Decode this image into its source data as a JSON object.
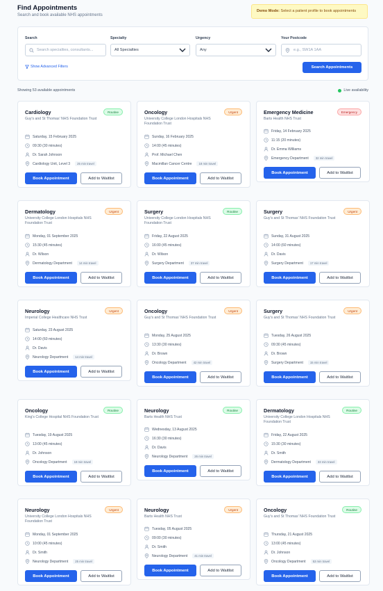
{
  "header": {
    "title": "Find Appointments",
    "subtitle": "Search and book available NHS appointments"
  },
  "demo": {
    "label": "Demo Mode:",
    "text": "Select a patient profile to book appointments"
  },
  "filters": {
    "search_label": "Search",
    "search_placeholder": "Search specialties, consultants...",
    "specialty_label": "Specialty",
    "specialty_value": "All Specialties",
    "urgency_label": "Urgency",
    "urgency_value": "Any",
    "postcode_label": "Your Postcode",
    "postcode_placeholder": "e.g., SW1A 1AA",
    "advanced_label": "Show Advanced Filters",
    "search_button": "Search Appointments"
  },
  "results": {
    "showing": "Showing 53 available appointments",
    "live": "Live availability"
  },
  "buttons": {
    "book": "Book Appointment",
    "waitlist": "Add to Waitlist"
  },
  "cards": [
    {
      "specialty": "Cardiology",
      "trust": "Guy's and St Thomas' NHS Foundation Trust",
      "urgency": "Routine",
      "date": "Saturday, 15 February 2025",
      "time": "09:30 (30 minutes)",
      "doctor": "Dr. Sarah Johnson",
      "location": "Cardiology Unit, Level 3",
      "travel": "25 min travel"
    },
    {
      "specialty": "Oncology",
      "trust": "University College London Hospitals NHS Foundation Trust",
      "urgency": "Urgent",
      "date": "Sunday, 16 February 2025",
      "time": "14:00 (45 minutes)",
      "doctor": "Prof. Michael Chen",
      "location": "Macmillan Cancer Centre",
      "travel": "18 min travel"
    },
    {
      "specialty": "Emergency Medicine",
      "trust": "Barts Health NHS Trust",
      "urgency": "Emergency",
      "date": "Friday, 14 February 2025",
      "time": "11:15 (20 minutes)",
      "doctor": "Dr. Emma Williams",
      "location": "Emergency Department",
      "travel": "32 min travel"
    },
    {
      "specialty": "Dermatology",
      "trust": "University College London Hospitals NHS Foundation Trust",
      "urgency": "Urgent",
      "date": "Monday, 01 September 2025",
      "time": "15:30 (45 minutes)",
      "doctor": "Dr. Wilson",
      "location": "Dermatology Department",
      "travel": "14 min travel"
    },
    {
      "specialty": "Surgery",
      "trust": "University College London Hospitals NHS Foundation Trust",
      "urgency": "Routine",
      "date": "Friday, 22 August 2025",
      "time": "16:00 (45 minutes)",
      "doctor": "Dr. Wilson",
      "location": "Surgery Department",
      "travel": "37 min travel"
    },
    {
      "specialty": "Surgery",
      "trust": "Guy's and St Thomas' NHS Foundation Trust",
      "urgency": "Urgent",
      "date": "Sunday, 31 August 2025",
      "time": "14:00 (60 minutes)",
      "doctor": "Dr. Davis",
      "location": "Surgery Department",
      "travel": "17 min travel"
    },
    {
      "specialty": "Neurology",
      "trust": "Imperial College Healthcare NHS Trust",
      "urgency": "Urgent",
      "date": "Saturday, 23 August 2025",
      "time": "14:00 (60 minutes)",
      "doctor": "Dr. Davis",
      "location": "Neurology Department",
      "travel": "14 min travel"
    },
    {
      "specialty": "Oncology",
      "trust": "Guy's and St Thomas' NHS Foundation Trust",
      "urgency": "Urgent",
      "date": "Monday, 25 August 2025",
      "time": "13:30 (30 minutes)",
      "doctor": "Dr. Brown",
      "location": "Oncology Department",
      "travel": "42 min travel"
    },
    {
      "specialty": "Surgery",
      "trust": "Guy's and St Thomas' NHS Foundation Trust",
      "urgency": "Urgent",
      "date": "Tuesday, 26 August 2025",
      "time": "09:30 (45 minutes)",
      "doctor": "Dr. Brown",
      "location": "Surgery Department",
      "travel": "15 min travel"
    },
    {
      "specialty": "Oncology",
      "trust": "King's College Hospital NHS Foundation Trust",
      "urgency": "Routine",
      "date": "Tuesday, 19 August 2025",
      "time": "13:00 (45 minutes)",
      "doctor": "Dr. Johnson",
      "location": "Oncology Department",
      "travel": "19 min travel"
    },
    {
      "specialty": "Neurology",
      "trust": "Barts Health NHS Trust",
      "urgency": "Routine",
      "date": "Wednesday, 13 August 2025",
      "time": "16:30 (30 minutes)",
      "doctor": "Dr. Davis",
      "location": "Neurology Department",
      "travel": "26 min travel"
    },
    {
      "specialty": "Dermatology",
      "trust": "University College London Hospitals NHS Foundation Trust",
      "urgency": "Routine",
      "date": "Friday, 22 August 2025",
      "time": "15:30 (30 minutes)",
      "doctor": "Dr. Smith",
      "location": "Dermatology Department",
      "travel": "33 min travel"
    },
    {
      "specialty": "Neurology",
      "trust": "University College London Hospitals NHS Foundation Trust",
      "urgency": "Urgent",
      "date": "Monday, 01 September 2025",
      "time": "10:00 (45 minutes)",
      "doctor": "Dr. Smith",
      "location": "Neurology Department",
      "travel": "25 min travel"
    },
    {
      "specialty": "Neurology",
      "trust": "Barts Health NHS Trust",
      "urgency": "Urgent",
      "date": "Tuesday, 05 August 2025",
      "time": "09:00 (30 minutes)",
      "doctor": "Dr. Smith",
      "location": "Neurology Department",
      "travel": "41 min travel"
    },
    {
      "specialty": "Oncology",
      "trust": "Guy's and St Thomas' NHS Foundation Trust",
      "urgency": "Routine",
      "date": "Thursday, 21 August 2025",
      "time": "13:00 (45 minutes)",
      "doctor": "Dr. Johnson",
      "location": "Oncology Department",
      "travel": "53 min travel"
    }
  ]
}
